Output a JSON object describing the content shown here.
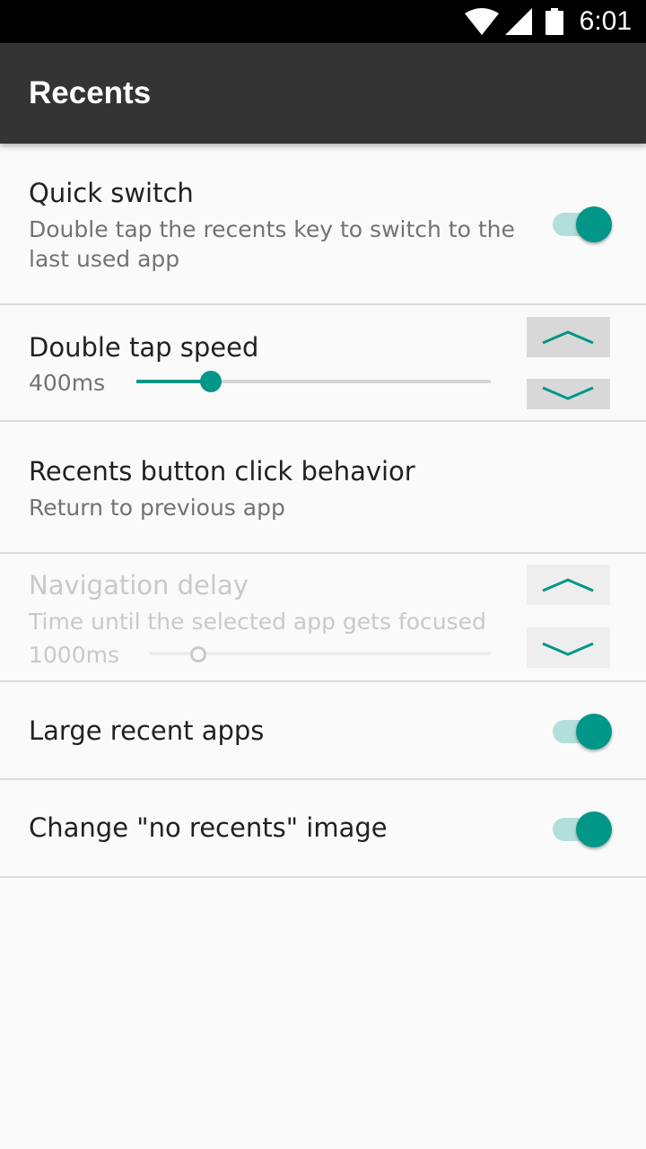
{
  "status_bar": {
    "time": "6:01",
    "icons": [
      "wifi-icon",
      "cell-signal-icon",
      "battery-icon"
    ]
  },
  "toolbar": {
    "title": "Recents"
  },
  "settings": {
    "quick_switch": {
      "title": "Quick switch",
      "summary": "Double tap the recents key to switch to the last used app",
      "enabled": true
    },
    "double_tap_speed": {
      "title": "Double tap speed",
      "value": "400ms",
      "slider_fraction": 0.21
    },
    "recents_button": {
      "title": "Recents button click behavior",
      "summary": "Return to previous app"
    },
    "navigation_delay": {
      "title": "Navigation delay",
      "summary": "Time until the selected app gets focused",
      "value": "1000ms",
      "slider_fraction": 0.14,
      "disabled": true
    },
    "large_recent_apps": {
      "title": "Large recent apps",
      "enabled": true
    },
    "no_recents_image": {
      "title": "Change \"no recents\" image",
      "enabled": true
    }
  },
  "colors": {
    "accent": "#009688",
    "accent_track": "#b2dfdb",
    "toolbar": "#343434",
    "background": "#fafafa"
  }
}
